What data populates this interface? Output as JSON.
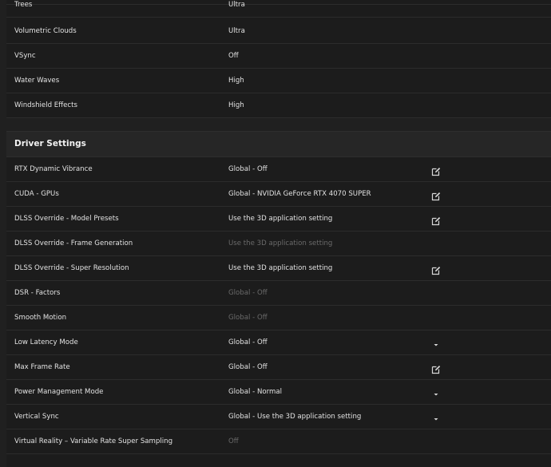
{
  "graphics": {
    "rows": [
      {
        "label": "Trees",
        "value": "Ultra"
      },
      {
        "label": "Volumetric Clouds",
        "value": "Ultra"
      },
      {
        "label": "VSync",
        "value": "Off"
      },
      {
        "label": "Water Waves",
        "value": "High"
      },
      {
        "label": "Windshield Effects",
        "value": "High"
      }
    ]
  },
  "driver": {
    "title": "Driver Settings",
    "rows": [
      {
        "label": "RTX Dynamic Vibrance",
        "value": "Global - Off",
        "action": "edit-icon",
        "disabled": false
      },
      {
        "label": "CUDA - GPUs",
        "value": "Global - NVIDIA GeForce RTX 4070 SUPER",
        "action": "edit-icon",
        "disabled": false
      },
      {
        "label": "DLSS Override - Model Presets",
        "value": "Use the 3D application setting",
        "action": "edit-icon",
        "disabled": false
      },
      {
        "label": "DLSS Override - Frame Generation",
        "value": "Use the 3D application setting",
        "action": "",
        "disabled": true
      },
      {
        "label": "DLSS Override - Super Resolution",
        "value": "Use the 3D application setting",
        "action": "edit-icon",
        "disabled": false
      },
      {
        "label": "DSR - Factors",
        "value": "Global - Off",
        "action": "",
        "disabled": true
      },
      {
        "label": "Smooth Motion",
        "value": "Global - Off",
        "action": "",
        "disabled": true
      },
      {
        "label": "Low Latency Mode",
        "value": "Global - Off",
        "action": "dropdown-arrow-icon",
        "disabled": false
      },
      {
        "label": "Max Frame Rate",
        "value": "Global - Off",
        "action": "edit-icon",
        "disabled": false
      },
      {
        "label": "Power Management Mode",
        "value": "Global - Normal",
        "action": "dropdown-arrow-icon",
        "disabled": false
      },
      {
        "label": "Vertical Sync",
        "value": "Global - Use the 3D application setting",
        "action": "dropdown-arrow-icon",
        "disabled": false
      },
      {
        "label": "Virtual Reality – Variable Rate Super Sampling",
        "value": "Off",
        "action": "",
        "disabled": true
      }
    ]
  },
  "colors": {
    "background": "#1c1c1c",
    "header_background": "#262626",
    "text": "#e2e2e2",
    "disabled_text": "#6a6a6a"
  }
}
